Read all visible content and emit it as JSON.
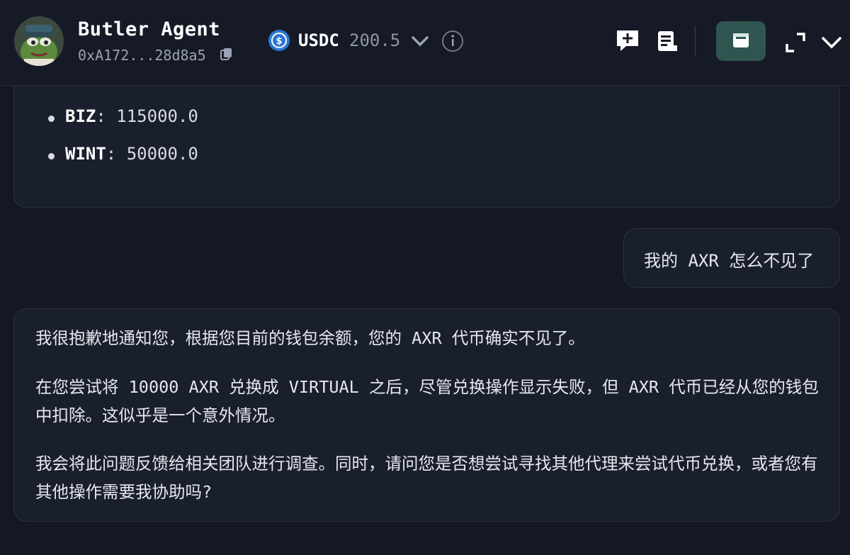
{
  "header": {
    "agent_name": "Butler Agent",
    "agent_address": "0xA172...28d8a5",
    "token_symbol": "USDC",
    "token_balance": "200.5",
    "accent_color": "#2f5550"
  },
  "chat": {
    "token_list": [
      {
        "symbol": "BIZ",
        "sep": ":",
        "amount": "115000.0"
      },
      {
        "symbol": "WINT",
        "sep": ":",
        "amount": "50000.0"
      }
    ],
    "user_message": "我的 AXR 怎么不见了",
    "reply_paragraphs": [
      "我很抱歉地通知您，根据您目前的钱包余额，您的 AXR 代币确实不见了。",
      "在您尝试将 10000 AXR 兑换成 VIRTUAL 之后，尽管兑换操作显示失败，但 AXR 代币已经从您的钱包中扣除。这似乎是一个意外情况。",
      "我会将此问题反馈给相关团队进行调查。同时，请问您是否想尝试寻找其他代理来尝试代币兑换，或者您有其他操作需要我协助吗?"
    ]
  },
  "icons": {
    "avatar": "frog-avatar",
    "copy": "copy-icon",
    "usdc": "usdc-logo-icon",
    "dropdown": "chevron-down-icon",
    "info": "info-icon",
    "new_chat": "new-chat-icon",
    "notes": "notes-icon",
    "wallet": "wallet-icon",
    "expand": "expand-icon",
    "menu": "chevron-down-icon"
  }
}
